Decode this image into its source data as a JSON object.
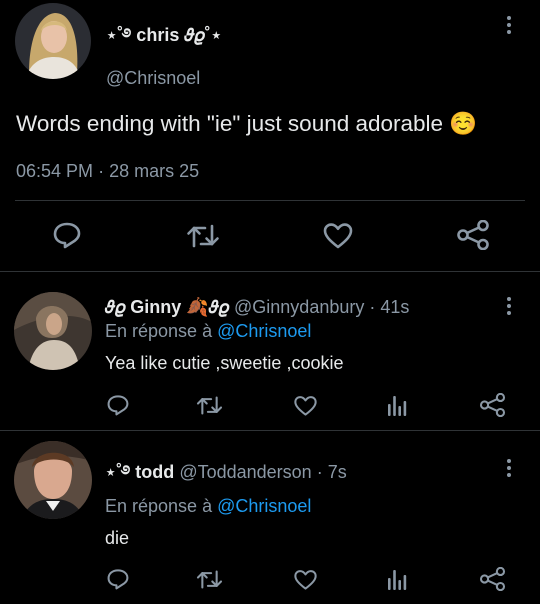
{
  "main_tweet": {
    "display_name": "⋆˚࿔ chris 𝜗𝜚˚⋆",
    "handle": "@Chrisnoel",
    "text": "Words ending with \"ie\" just sound adorable ☺️",
    "time": "06:54 PM",
    "separator": "·",
    "date": "28 mars 25"
  },
  "replies": [
    {
      "display_name": "𝜗𝜚 Ginny 🍂𝜗𝜚",
      "handle": "@Ginnydanbury",
      "time": "· 41s",
      "reply_prefix": "En réponse à",
      "reply_to": "@Chrisnoel",
      "text": "Yea like cutie ,sweetie ,cookie"
    },
    {
      "display_name": "⋆˚࿔ todd",
      "handle": "@Toddanderson",
      "time": "· 7s",
      "reply_prefix": "En réponse à",
      "reply_to": "@Chrisnoel",
      "text": "die"
    }
  ],
  "icons": {
    "reply": "reply-icon",
    "retweet": "retweet-icon",
    "like": "like-icon",
    "views": "views-icon",
    "share": "share-icon",
    "more": "more-icon"
  },
  "colors": {
    "background": "#000000",
    "text": "#e7e9ea",
    "secondary_text": "#8b98a5",
    "link": "#1d9bf0",
    "divider": "#2f3336"
  }
}
